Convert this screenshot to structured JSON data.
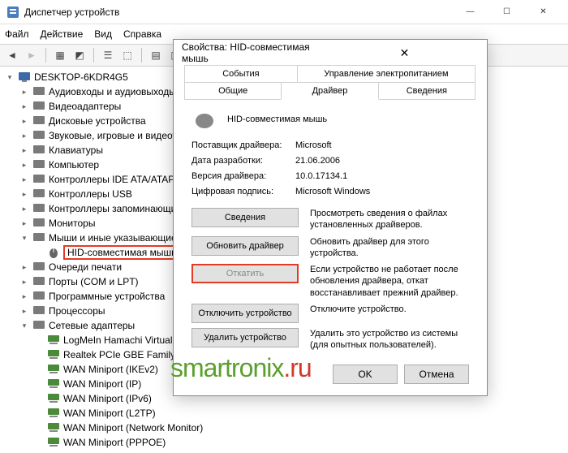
{
  "window": {
    "title": "Диспетчер устройств"
  },
  "menu": {
    "file": "Файл",
    "action": "Действие",
    "view": "Вид",
    "help": "Справка"
  },
  "tree": {
    "root": "DESKTOP-6KDR4G5",
    "cats": [
      "Аудиовходы и аудиовыходы",
      "Видеоадаптеры",
      "Дисковые устройства",
      "Звуковые, игровые и видеоустройства",
      "Клавиатуры",
      "Компьютер",
      "Контроллеры IDE ATA/ATAPI",
      "Контроллеры USB",
      "Контроллеры запоминающих устройств",
      "Мониторы",
      "Мыши и иные указывающие устройства",
      "Очереди печати",
      "Порты (COM и LPT)",
      "Программные устройства",
      "Процессоры",
      "Сетевые адаптеры"
    ],
    "mouse_item": "HID-совместимая мышь",
    "net": [
      "LogMeIn Hamachi Virtual Ethernet",
      "Realtek PCIe GBE Family Controller",
      "WAN Miniport (IKEv2)",
      "WAN Miniport (IP)",
      "WAN Miniport (IPv6)",
      "WAN Miniport (L2TP)",
      "WAN Miniport (Network Monitor)",
      "WAN Miniport (PPPOE)"
    ]
  },
  "dialog": {
    "title": "Свойства: HID-совместимая мышь",
    "tabs": {
      "events": "События",
      "power": "Управление электропитанием",
      "general": "Общие",
      "driver": "Драйвер",
      "details": "Сведения"
    },
    "device_name": "HID-совместимая мышь",
    "props": {
      "vendor_k": "Поставщик драйвера:",
      "vendor_v": "Microsoft",
      "date_k": "Дата разработки:",
      "date_v": "21.06.2006",
      "ver_k": "Версия драйвера:",
      "ver_v": "10.0.17134.1",
      "sig_k": "Цифровая подпись:",
      "sig_v": "Microsoft Windows"
    },
    "actions": {
      "details_btn": "Сведения",
      "details_desc": "Просмотреть сведения о файлах установленных драйверов.",
      "update_btn": "Обновить драйвер",
      "update_desc": "Обновить драйвер для этого устройства.",
      "rollback_btn": "Откатить",
      "rollback_desc": "Если устройство не работает после обновления драйвера, откат восстанавливает прежний драйвер.",
      "disable_btn": "Отключить устройство",
      "disable_desc": "Отключите устройство.",
      "uninstall_btn": "Удалить устройство",
      "uninstall_desc": "Удалить это устройство из системы (для опытных пользователей)."
    },
    "ok": "OK",
    "cancel": "Отмена"
  },
  "watermark": {
    "a": "smartronix",
    "b": ".ru"
  }
}
